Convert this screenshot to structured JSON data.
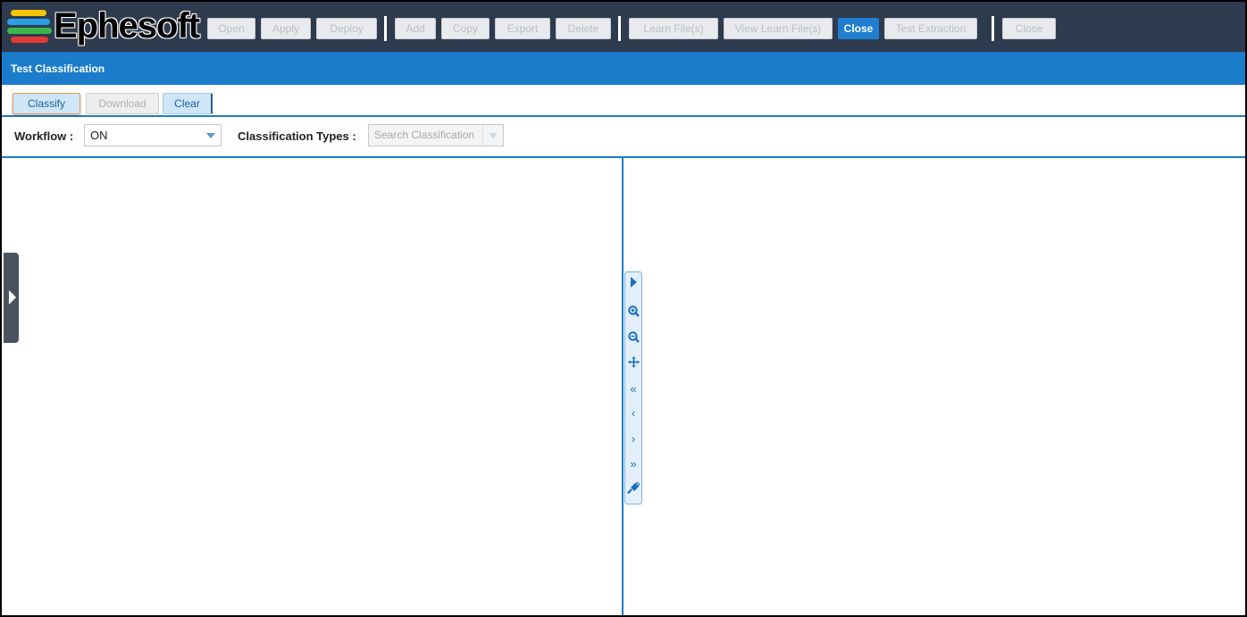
{
  "app": {
    "brand": "Ephesoft",
    "brand_colors": [
      "#f5c400",
      "#2b9de8",
      "#3cb54a",
      "#e53935"
    ]
  },
  "toolbar": {
    "buttons": [
      {
        "label": "Open",
        "state": "disabled"
      },
      {
        "label": "Apply",
        "state": "disabled"
      },
      {
        "label": "Deploy",
        "state": "disabled"
      },
      {
        "label": "Add",
        "state": "disabled"
      },
      {
        "label": "Copy",
        "state": "disabled"
      },
      {
        "label": "Export",
        "state": "disabled"
      },
      {
        "label": "Delete",
        "state": "disabled"
      },
      {
        "label": "Learn File(s)",
        "state": "disabled"
      },
      {
        "label": "View Learn File(s)",
        "state": "disabled"
      },
      {
        "label": "Close",
        "state": "active"
      },
      {
        "label": "Test Extraction",
        "state": "disabled"
      },
      {
        "label": "Close",
        "state": "disabled"
      }
    ]
  },
  "panel": {
    "title": "Test Classification"
  },
  "actions": {
    "classify": "Classify",
    "download": "Download",
    "clear": "Clear"
  },
  "filters": {
    "workflow_label": "Workflow :",
    "workflow_value": "ON",
    "types_label": "Classification Types :",
    "types_placeholder": "Search Classification"
  },
  "viewer_tools": [
    {
      "name": "play-icon"
    },
    {
      "name": "zoom-in-icon"
    },
    {
      "name": "zoom-out-icon"
    },
    {
      "name": "move-icon"
    },
    {
      "name": "first-page-icon",
      "glyph": "«"
    },
    {
      "name": "previous-page-icon",
      "glyph": "‹"
    },
    {
      "name": "next-page-icon",
      "glyph": "›"
    },
    {
      "name": "last-page-icon",
      "glyph": "»"
    },
    {
      "name": "plug-icon"
    }
  ],
  "colors": {
    "header_bg": "#2e3b4e",
    "accent": "#1a7cca",
    "active_button": "#1f7ed0"
  }
}
